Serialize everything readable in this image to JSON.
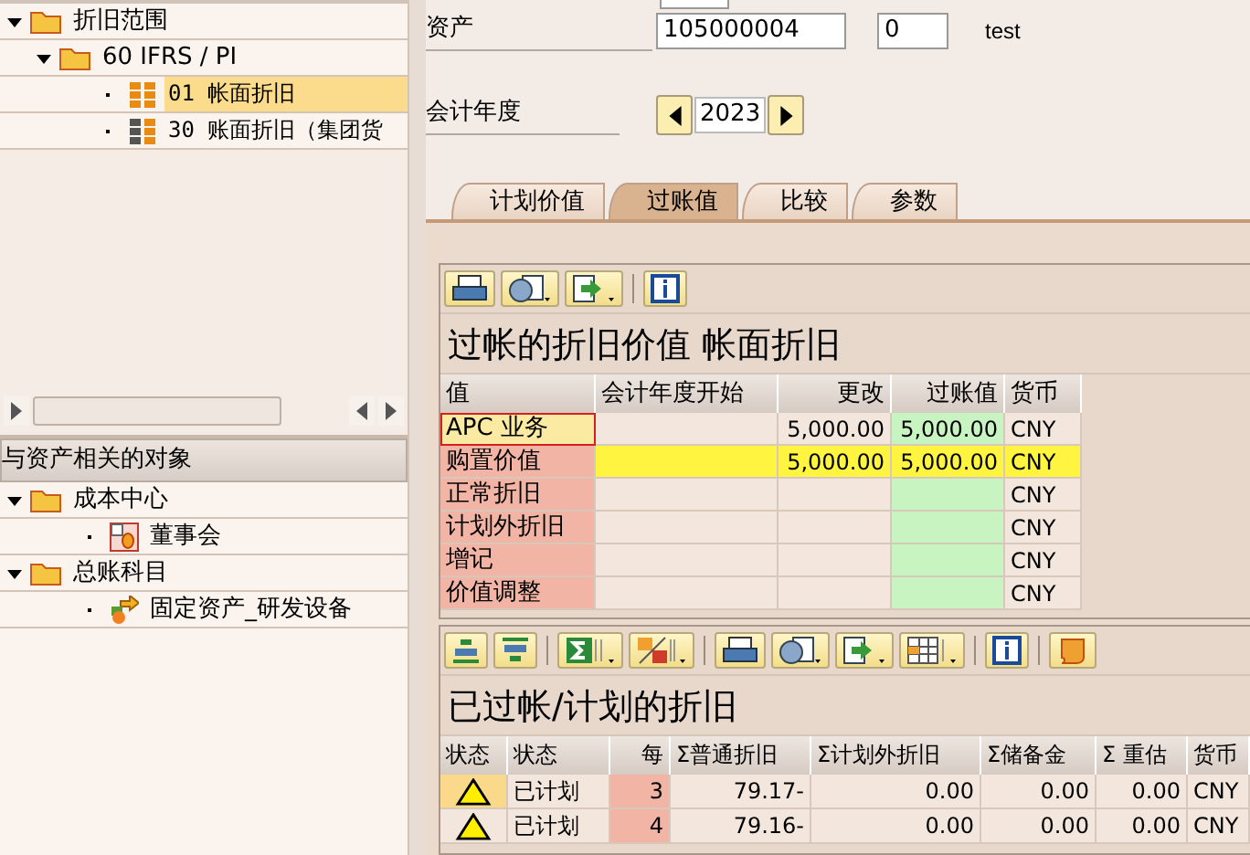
{
  "depreciation_tree": {
    "items": [
      {
        "label": "折旧范围",
        "expanded": true,
        "children": [
          {
            "label": "60 IFRS / PI",
            "expanded": true,
            "children": [
              {
                "label": "01 帐面折旧",
                "selected": true
              },
              {
                "label": "30 账面折旧（集团货",
                "selected": false
              }
            ]
          }
        ]
      }
    ]
  },
  "related_objects": {
    "title": "与资产相关的对象",
    "items": [
      {
        "label": "成本中心",
        "expanded": true,
        "children": [
          {
            "label": "董事会",
            "kind": "cost-center"
          }
        ]
      },
      {
        "label": "总账科目",
        "expanded": true,
        "children": [
          {
            "label": "固定资产_研发设备",
            "kind": "account"
          }
        ]
      }
    ]
  },
  "asset": {
    "label": "资产",
    "number": "105000004",
    "sub_number": "0",
    "description": "test"
  },
  "fiscal_year": {
    "label": "会计年度",
    "value": "2023"
  },
  "tabs": [
    {
      "label": "计划价值",
      "selected": false
    },
    {
      "label": "过账值",
      "selected": true
    },
    {
      "label": "比较",
      "selected": false
    },
    {
      "label": "参数",
      "selected": false
    }
  ],
  "posted_values": {
    "title": "过帐的折旧价值 帐面折旧",
    "columns": [
      "值",
      "会计年度开始",
      "更改",
      "过账值",
      "货币"
    ],
    "rows": [
      {
        "value": "APC 业务",
        "change": "5,000.00",
        "posted": "5,000.00",
        "currency": "CNY",
        "focused": true,
        "highlighted": false
      },
      {
        "value": "购置价值",
        "change": "5,000.00",
        "posted": "5,000.00",
        "currency": "CNY",
        "focused": false,
        "highlighted": true
      },
      {
        "value": "正常折旧",
        "currency": "CNY",
        "focused": false,
        "highlighted": false
      },
      {
        "value": "计划外折旧",
        "currency": "CNY",
        "focused": false,
        "highlighted": false
      },
      {
        "value": "增记",
        "currency": "CNY",
        "focused": false,
        "highlighted": false
      },
      {
        "value": "价值调整",
        "currency": "CNY",
        "focused": false,
        "highlighted": false
      }
    ]
  },
  "depreciation_schedule": {
    "title": "已过帐/计划的折旧",
    "columns": [
      "状态",
      "状态",
      "每",
      "Σ普通折旧",
      "Σ计划外折旧",
      "Σ储备金",
      "Σ 重估",
      "货币"
    ],
    "rows": [
      {
        "kind": "warning",
        "status_text": "已计划",
        "period": "3",
        "ordinary": "79.17-",
        "unplanned": "0.00",
        "reserves": "0.00",
        "revaluation": "0.00",
        "currency": "CNY",
        "selected": true
      },
      {
        "kind": "warning",
        "status_text": "已计划",
        "period": "4",
        "ordinary": "79.16-",
        "unplanned": "0.00",
        "reserves": "0.00",
        "revaluation": "0.00",
        "currency": "CNY",
        "selected": false
      }
    ]
  }
}
